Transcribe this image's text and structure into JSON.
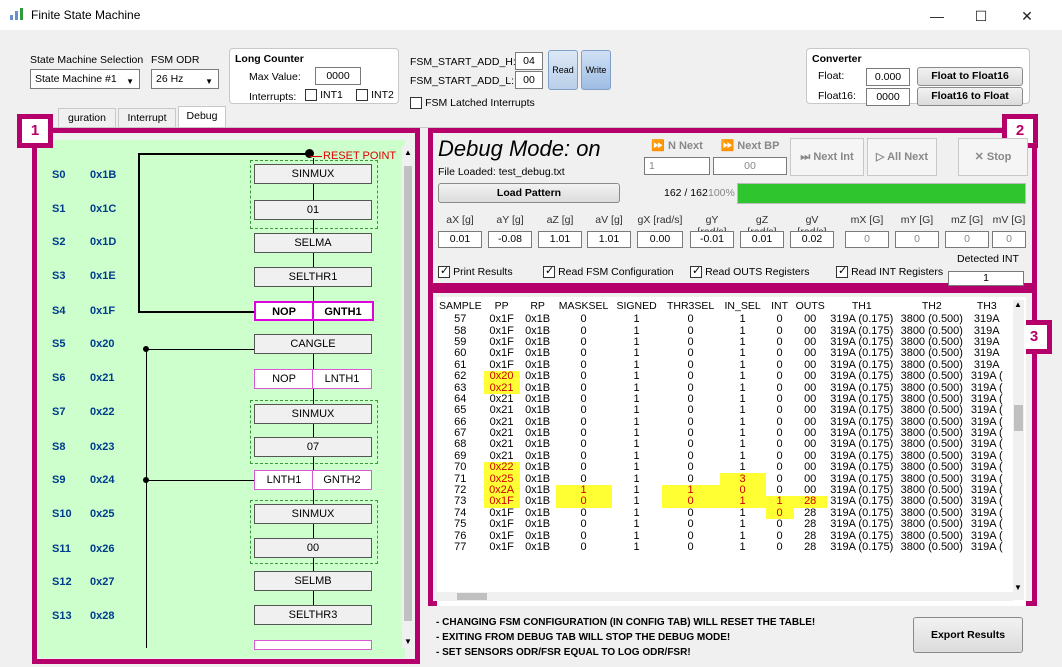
{
  "window": {
    "title": "Finite State Machine",
    "minimize": "—",
    "maximize": "☐",
    "close": "✕"
  },
  "top": {
    "sm_selection_label": "State Machine Selection",
    "sm_selection_value": "State Machine #1",
    "fsm_odr_label": "FSM ODR",
    "fsm_odr_value": "26 Hz",
    "long_counter": {
      "title": "Long Counter",
      "max_value_label": "Max Value:",
      "max_value": "0000",
      "interrupts_label": "Interrupts:",
      "int1": "INT1",
      "int2": "INT2"
    },
    "start_add_h_label": "FSM_START_ADD_H:",
    "start_add_h": "04",
    "start_add_l_label": "FSM_START_ADD_L:",
    "start_add_l": "00",
    "read": "Read",
    "write": "Write",
    "latched": "FSM Latched Interrupts",
    "converter": {
      "title": "Converter",
      "float_label": "Float:",
      "float_value": "0.000",
      "float16_label": "Float16:",
      "float16_value": "0000",
      "to_float16": "Float to Float16",
      "to_float": "Float16 to Float"
    }
  },
  "tabs": [
    "guration",
    "Interrupt",
    "Debug"
  ],
  "badges": [
    "1",
    "2",
    "3"
  ],
  "fsm": {
    "reset_point": "RESET POINT",
    "rows": [
      {
        "s": "S0",
        "addr": "0x1B"
      },
      {
        "s": "S1",
        "addr": "0x1C"
      },
      {
        "s": "S2",
        "addr": "0x1D"
      },
      {
        "s": "S3",
        "addr": "0x1E"
      },
      {
        "s": "S4",
        "addr": "0x1F"
      },
      {
        "s": "S5",
        "addr": "0x20"
      },
      {
        "s": "S6",
        "addr": "0x21"
      },
      {
        "s": "S7",
        "addr": "0x22"
      },
      {
        "s": "S8",
        "addr": "0x23"
      },
      {
        "s": "S9",
        "addr": "0x24"
      },
      {
        "s": "S10",
        "addr": "0x25"
      },
      {
        "s": "S11",
        "addr": "0x26"
      },
      {
        "s": "S12",
        "addr": "0x27"
      },
      {
        "s": "S13",
        "addr": "0x28"
      }
    ],
    "states": [
      "SINMUX",
      "01",
      "SELMA",
      "SELTHR1",
      "NOP",
      "GNTH1",
      "CANGLE",
      "NOP",
      "LNTH1",
      "SINMUX",
      "07",
      "LNTH1",
      "GNTH2",
      "SINMUX",
      "00",
      "SELMB",
      "SELTHR3"
    ]
  },
  "debug": {
    "title": "Debug Mode: on",
    "file_loaded": "File Loaded: test_debug.txt",
    "load_pattern": "Load Pattern",
    "progress_text": "162 / 162",
    "progress_pct": "100%",
    "progress_fraction": 1.0,
    "n_next": "N Next",
    "n_next_value": "1",
    "next_bp": "Next BP",
    "next_bp_value": "00",
    "next_int": "Next Int",
    "all_next": "All Next",
    "stop": "Stop",
    "sensors": [
      {
        "label": "aX [g]",
        "value": "0.01",
        "gray": false
      },
      {
        "label": "aY [g]",
        "value": "-0.08",
        "gray": false
      },
      {
        "label": "aZ [g]",
        "value": "1.01",
        "gray": false
      },
      {
        "label": "aV [g]",
        "value": "1.01",
        "gray": false
      },
      {
        "label": "gX [rad/s]",
        "value": "0.00",
        "gray": false
      },
      {
        "label": "gY [rad/s]",
        "value": "-0.01",
        "gray": false
      },
      {
        "label": "gZ [rad/s]",
        "value": "0.01",
        "gray": false
      },
      {
        "label": "gV [rad/s]",
        "value": "0.02",
        "gray": false
      },
      {
        "label": "mX [G]",
        "value": "0",
        "gray": true
      },
      {
        "label": "mY [G]",
        "value": "0",
        "gray": true
      },
      {
        "label": "mZ [G]",
        "value": "0",
        "gray": true
      },
      {
        "label": "mV [G]",
        "value": "0",
        "gray": true
      }
    ],
    "print_results": "Print Results",
    "read_fsm_config": "Read FSM Configuration",
    "read_outs": "Read OUTS Registers",
    "read_int": "Read INT Registers",
    "detected_int_label": "Detected INT",
    "detected_int_value": "1"
  },
  "table": {
    "columns": [
      "SAMPLE",
      "PP",
      "RP",
      "MASKSEL",
      "SIGNED",
      "THR3SEL",
      "IN_SEL",
      "INT",
      "OUTS",
      "TH1",
      "TH2",
      "TH3"
    ],
    "rows": [
      [
        "57",
        "0x1F",
        "0x1B",
        "0",
        "1",
        "0",
        "1",
        "0",
        "00",
        "319A (0.175)",
        "3800 (0.500)",
        "319A"
      ],
      [
        "58",
        "0x1F",
        "0x1B",
        "0",
        "1",
        "0",
        "1",
        "0",
        "00",
        "319A (0.175)",
        "3800 (0.500)",
        "319A"
      ],
      [
        "59",
        "0x1F",
        "0x1B",
        "0",
        "1",
        "0",
        "1",
        "0",
        "00",
        "319A (0.175)",
        "3800 (0.500)",
        "319A"
      ],
      [
        "60",
        "0x1F",
        "0x1B",
        "0",
        "1",
        "0",
        "1",
        "0",
        "00",
        "319A (0.175)",
        "3800 (0.500)",
        "319A"
      ],
      [
        "61",
        "0x1F",
        "0x1B",
        "0",
        "1",
        "0",
        "1",
        "0",
        "00",
        "319A (0.175)",
        "3800 (0.500)",
        "319A"
      ],
      [
        "62",
        "0x20",
        "0x1B",
        "0",
        "1",
        "0",
        "1",
        "0",
        "00",
        "319A (0.175)",
        "3800 (0.500)",
        "319A ("
      ],
      [
        "63",
        "0x21",
        "0x1B",
        "0",
        "1",
        "0",
        "1",
        "0",
        "00",
        "319A (0.175)",
        "3800 (0.500)",
        "319A ("
      ],
      [
        "64",
        "0x21",
        "0x1B",
        "0",
        "1",
        "0",
        "1",
        "0",
        "00",
        "319A (0.175)",
        "3800 (0.500)",
        "319A ("
      ],
      [
        "65",
        "0x21",
        "0x1B",
        "0",
        "1",
        "0",
        "1",
        "0",
        "00",
        "319A (0.175)",
        "3800 (0.500)",
        "319A ("
      ],
      [
        "66",
        "0x21",
        "0x1B",
        "0",
        "1",
        "0",
        "1",
        "0",
        "00",
        "319A (0.175)",
        "3800 (0.500)",
        "319A ("
      ],
      [
        "67",
        "0x21",
        "0x1B",
        "0",
        "1",
        "0",
        "1",
        "0",
        "00",
        "319A (0.175)",
        "3800 (0.500)",
        "319A ("
      ],
      [
        "68",
        "0x21",
        "0x1B",
        "0",
        "1",
        "0",
        "1",
        "0",
        "00",
        "319A (0.175)",
        "3800 (0.500)",
        "319A ("
      ],
      [
        "69",
        "0x21",
        "0x1B",
        "0",
        "1",
        "0",
        "1",
        "0",
        "00",
        "319A (0.175)",
        "3800 (0.500)",
        "319A ("
      ],
      [
        "70",
        "0x22",
        "0x1B",
        "0",
        "1",
        "0",
        "1",
        "0",
        "00",
        "319A (0.175)",
        "3800 (0.500)",
        "319A ("
      ],
      [
        "71",
        "0x25",
        "0x1B",
        "0",
        "1",
        "0",
        "3",
        "0",
        "00",
        "319A (0.175)",
        "3800 (0.500)",
        "319A ("
      ],
      [
        "72",
        "0x2A",
        "0x1B",
        "1",
        "1",
        "1",
        "0",
        "0",
        "00",
        "319A (0.175)",
        "3800 (0.500)",
        "319A ("
      ],
      [
        "73",
        "0x1F",
        "0x1B",
        "0",
        "1",
        "0",
        "1",
        "1",
        "28",
        "319A (0.175)",
        "3800 (0.500)",
        "319A ("
      ],
      [
        "74",
        "0x1F",
        "0x1B",
        "0",
        "1",
        "0",
        "1",
        "0",
        "28",
        "319A (0.175)",
        "3800 (0.500)",
        "319A ("
      ],
      [
        "75",
        "0x1F",
        "0x1B",
        "0",
        "1",
        "0",
        "1",
        "0",
        "28",
        "319A (0.175)",
        "3800 (0.500)",
        "319A ("
      ],
      [
        "76",
        "0x1F",
        "0x1B",
        "0",
        "1",
        "0",
        "1",
        "0",
        "28",
        "319A (0.175)",
        "3800 (0.500)",
        "319A ("
      ],
      [
        "77",
        "0x1F",
        "0x1B",
        "0",
        "1",
        "0",
        "1",
        "0",
        "28",
        "319A (0.175)",
        "3800 (0.500)",
        "319A ("
      ]
    ],
    "highlights": [
      [
        5,
        1
      ],
      [
        6,
        1
      ],
      [
        13,
        1
      ],
      [
        14,
        1
      ],
      [
        14,
        6
      ],
      [
        15,
        1
      ],
      [
        15,
        3
      ],
      [
        15,
        5
      ],
      [
        15,
        6
      ],
      [
        16,
        1
      ],
      [
        16,
        3
      ],
      [
        16,
        5
      ],
      [
        16,
        6
      ],
      [
        16,
        7
      ],
      [
        16,
        8
      ],
      [
        17,
        7
      ]
    ]
  },
  "notes": [
    "- CHANGING FSM CONFIGURATION (IN CONFIG TAB) WILL RESET THE TABLE!",
    "- EXITING FROM DEBUG TAB WILL STOP THE DEBUG MODE!",
    "- SET SENSORS ODR/FSR EQUAL TO LOG ODR/FSR!"
  ],
  "export_results": "Export Results",
  "colors": {
    "frame": "#b5006b",
    "fsm_bg": "#ccffcc",
    "progress": "#2ec52e",
    "highlight": "#ffff33",
    "highlight_text": "#d00000"
  }
}
